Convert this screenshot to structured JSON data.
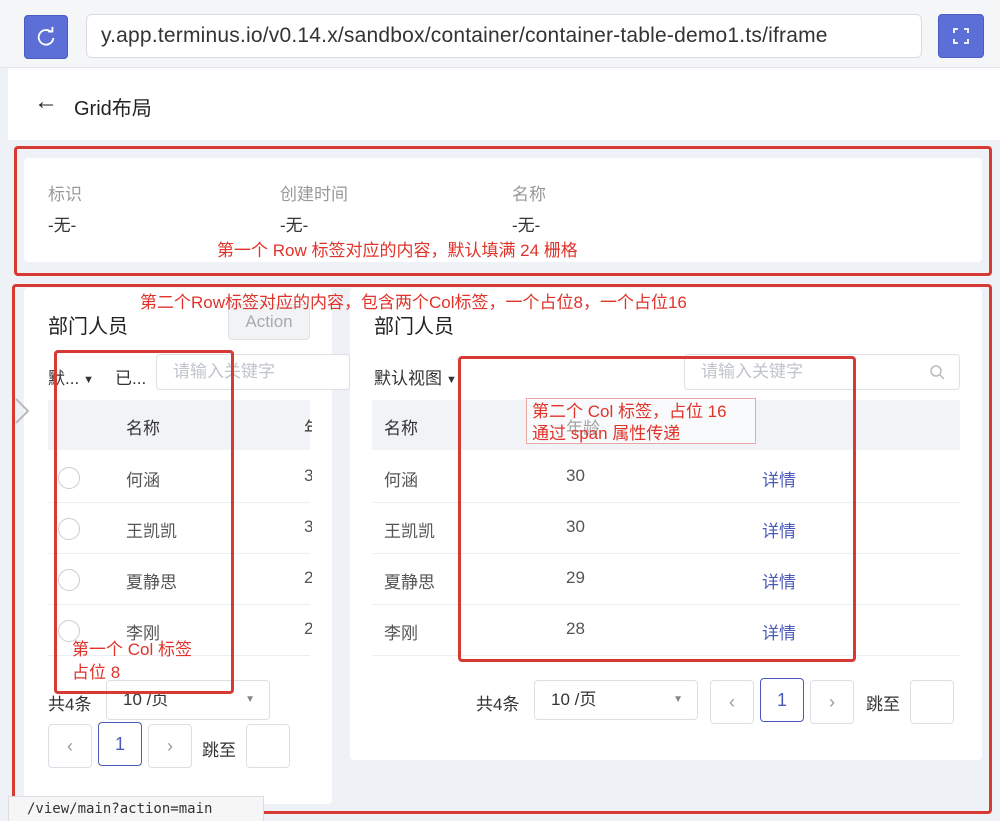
{
  "toolbar": {
    "url": "y.app.terminus.io/v0.14.x/sandbox/container/container-table-demo1.ts/iframe"
  },
  "header": {
    "title": "Grid布局"
  },
  "info": {
    "fields": [
      {
        "label": "标识",
        "value": "-无-"
      },
      {
        "label": "创建时间",
        "value": "-无-"
      },
      {
        "label": "名称",
        "value": "-无-"
      }
    ]
  },
  "left_table": {
    "title": "部门人员",
    "action_label": "Action",
    "view_select": "默...",
    "filter_chip": "已...",
    "search_placeholder": "请输入关键字",
    "col_name": "名称",
    "col_cut": "年",
    "rows": [
      {
        "name": "何涵",
        "age_cut": "3"
      },
      {
        "name": "王凯凯",
        "age_cut": "3"
      },
      {
        "name": "夏静思",
        "age_cut": "2"
      },
      {
        "name": "李刚",
        "age_cut": "2"
      }
    ],
    "total": "共4条",
    "page_size": "10 /页",
    "page": "1",
    "jump_label": "跳至"
  },
  "right_table": {
    "title": "部门人员",
    "view_select": "默认视图",
    "search_placeholder": "请输入关键字",
    "col_name": "名称",
    "col_age": "年龄",
    "rows": [
      {
        "name": "何涵",
        "age": "30",
        "action": "详情"
      },
      {
        "name": "王凯凯",
        "age": "30",
        "action": "详情"
      },
      {
        "name": "夏静思",
        "age": "29",
        "action": "详情"
      },
      {
        "name": "李刚",
        "age": "28",
        "action": "详情"
      }
    ],
    "total": "共4条",
    "page_size": "10 /页",
    "page": "1",
    "jump_label": "跳至"
  },
  "annotations": {
    "row1": "第一个 Row 标签对应的内容，默认填满 24 栅格",
    "row2": "第二个Row标签对应的内容，包含两个Col标签，一个占位8，一个占位16",
    "col2_line1": "第二个 Col 标签，占位 16",
    "col2_line2": "通过 span 属性传递",
    "col1_line1": "第一个 Col 标签",
    "col1_line2": "占位 8"
  },
  "status_bar": {
    "text": "/view/main?action=main"
  },
  "colors": {
    "accent": "#5b6fd6",
    "annotation_red": "#d63a33",
    "link": "#4a5ab8"
  }
}
